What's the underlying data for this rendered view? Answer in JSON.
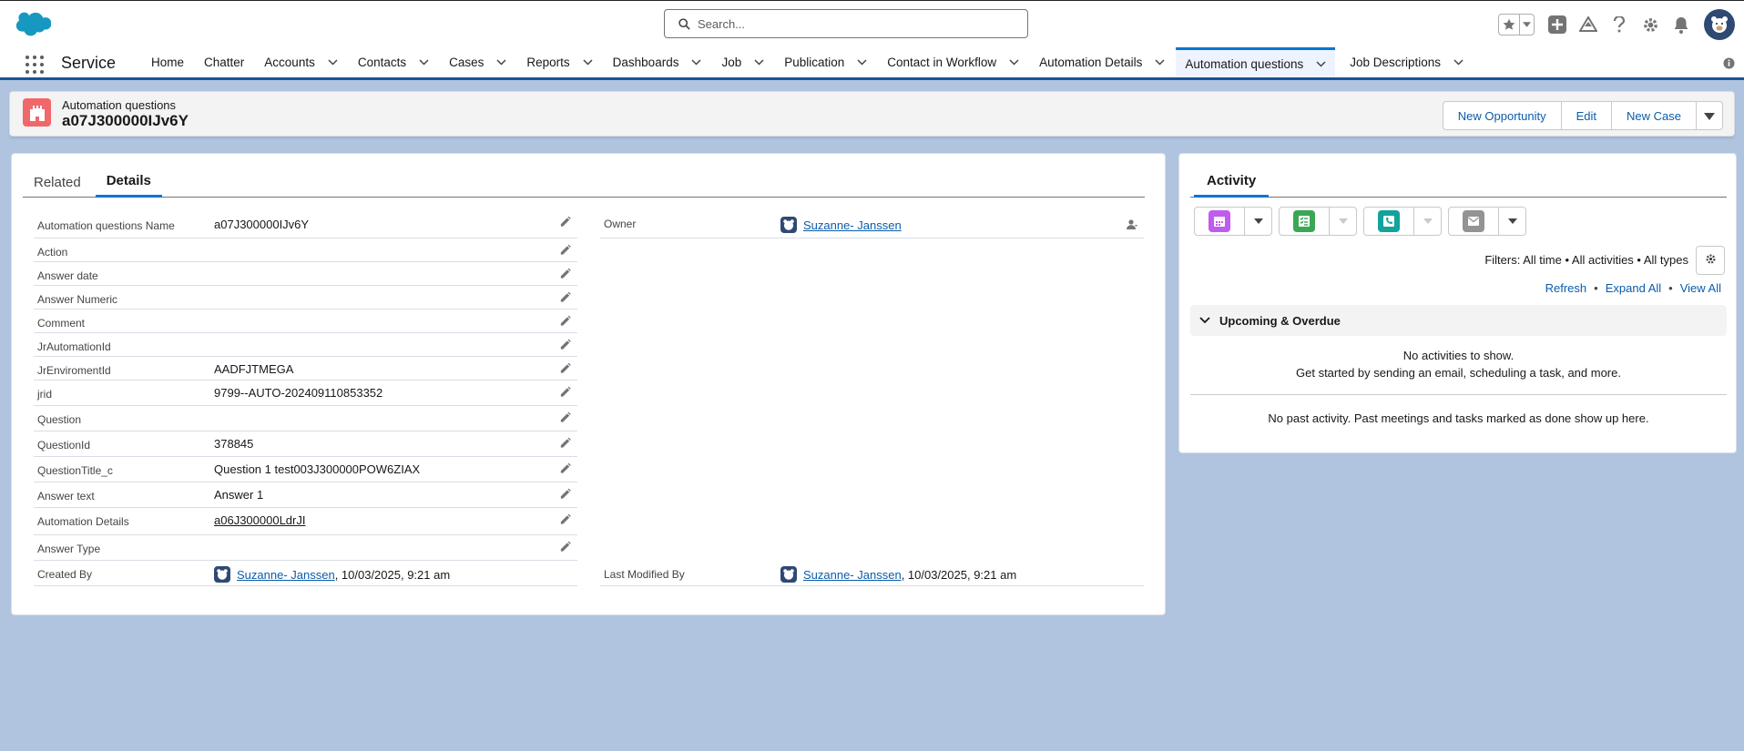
{
  "header": {
    "search_placeholder": "Search..."
  },
  "nav": {
    "app_name": "Service",
    "items": [
      {
        "label": "Home",
        "dropdown": false
      },
      {
        "label": "Chatter",
        "dropdown": false
      },
      {
        "label": "Accounts",
        "dropdown": true
      },
      {
        "label": "Contacts",
        "dropdown": true
      },
      {
        "label": "Cases",
        "dropdown": true
      },
      {
        "label": "Reports",
        "dropdown": true
      },
      {
        "label": "Dashboards",
        "dropdown": true
      },
      {
        "label": "Job",
        "dropdown": true
      },
      {
        "label": "Publication",
        "dropdown": true
      },
      {
        "label": "Contact in Workflow",
        "dropdown": true
      },
      {
        "label": "Automation Details",
        "dropdown": true
      },
      {
        "label": "Automation questions",
        "dropdown": true,
        "active": true
      },
      {
        "label": "Job Descriptions",
        "dropdown": true
      }
    ]
  },
  "record": {
    "object_type": "Automation questions",
    "name": "a07J300000IJv6Y",
    "actions": [
      "New Opportunity",
      "Edit",
      "New Case"
    ]
  },
  "tabs": [
    "Related",
    "Details"
  ],
  "fields_left": [
    {
      "label": "Automation questions Name",
      "value": "a07J300000IJv6Y",
      "editable": true
    },
    {
      "label": "Action",
      "value": "",
      "editable": true
    },
    {
      "label": "Answer date",
      "value": "",
      "editable": true
    },
    {
      "label": "Answer Numeric",
      "value": "",
      "editable": true
    },
    {
      "label": "Comment",
      "value": "",
      "editable": true
    },
    {
      "label": "JrAutomationId",
      "value": "",
      "editable": true
    },
    {
      "label": "JrEnviromentId",
      "value": "AADFJTMEGA",
      "editable": true
    },
    {
      "label": "jrid",
      "value": "9799--AUTO-202409110853352",
      "editable": true
    },
    {
      "label": "Question",
      "value": "",
      "editable": true
    },
    {
      "label": "QuestionId",
      "value": "378845",
      "editable": true
    },
    {
      "label": "QuestionTitle_c",
      "value": "Question 1 test003J300000POW6ZIAX",
      "editable": true
    },
    {
      "label": "Answer text",
      "value": "Answer 1",
      "editable": true
    },
    {
      "label": "Automation Details",
      "value": "a06J300000LdrJI",
      "link": true,
      "editable": true
    },
    {
      "label": "Answer Type",
      "value": "",
      "editable": true
    }
  ],
  "owner": {
    "label": "Owner",
    "value": "Suzanne- Janssen"
  },
  "created_by": {
    "label": "Created By",
    "user": "Suzanne- Janssen",
    "date": ", 10/03/2025, 9:21 am"
  },
  "last_modified_by": {
    "label": "Last Modified By",
    "user": "Suzanne- Janssen",
    "date": ", 10/03/2025, 9:21 am"
  },
  "activity": {
    "tab": "Activity",
    "filters": "Filters: All time • All activities • All types",
    "links": [
      "Refresh",
      "Expand All",
      "View All"
    ],
    "upcoming_label": "Upcoming & Overdue",
    "no_activities": "No activities to show.",
    "get_started": "Get started by sending an email, scheduling a task, and more.",
    "no_past": "No past activity. Past meetings and tasks marked as done show up here.",
    "quick_actions": [
      {
        "icon": "calendar-icon",
        "color": "#c05bf0"
      },
      {
        "icon": "task-icon",
        "color": "#3ba755"
      },
      {
        "icon": "call-icon",
        "color": "#12a39d"
      },
      {
        "icon": "email-icon",
        "color": "#939393"
      }
    ]
  },
  "colors": {
    "brand_blue": "#0176d3",
    "link": "#0b5cab",
    "background": "#b0c4df",
    "object_icon": "#f0686b"
  }
}
